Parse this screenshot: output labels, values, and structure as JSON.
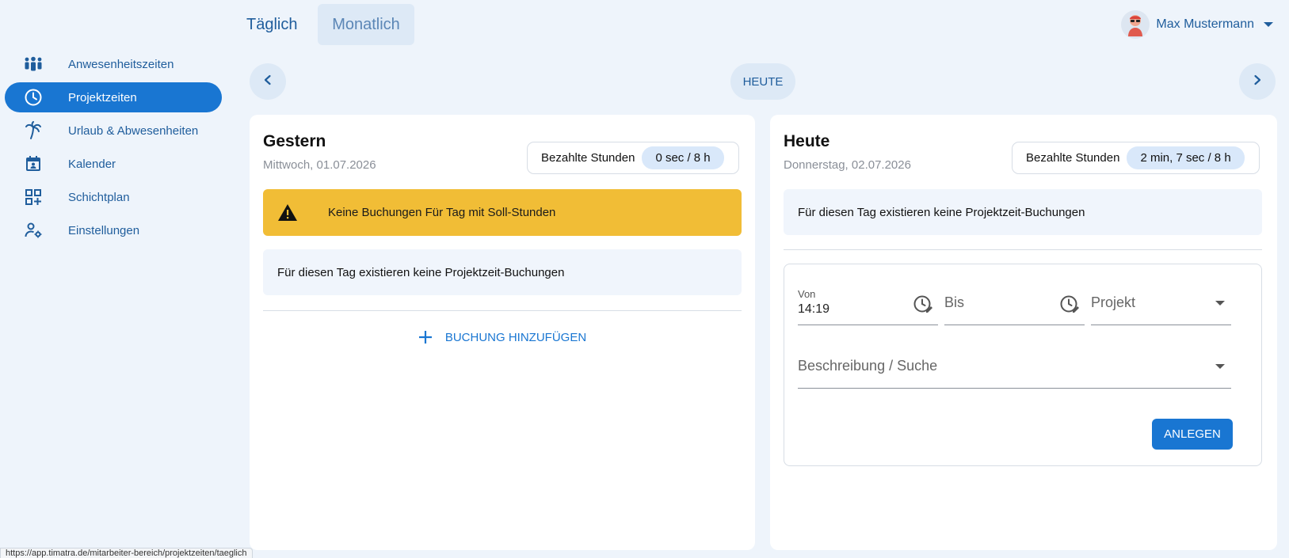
{
  "sidebar": {
    "items": [
      {
        "label": "Anwesenheitszeiten",
        "icon": "people-icon"
      },
      {
        "label": "Projektzeiten",
        "icon": "clock-icon",
        "active": true
      },
      {
        "label": "Urlaub & Abwesenheiten",
        "icon": "palm-tree-icon"
      },
      {
        "label": "Kalender",
        "icon": "calendar-icon"
      },
      {
        "label": "Schichtplan",
        "icon": "grid-plus-icon"
      },
      {
        "label": "Einstellungen",
        "icon": "user-settings-icon"
      }
    ]
  },
  "header": {
    "tab_daily": "Täglich",
    "tab_monthly": "Monatlich",
    "user_name": "Max Mustermann"
  },
  "date_nav": {
    "today_label": "HEUTE"
  },
  "left_card": {
    "title": "Gestern",
    "date": "Mittwoch, 01.07.2026",
    "paid_hours_label": "Bezahlte Stunden",
    "paid_hours_value": "0 sec / 8 h",
    "warning": "Keine Buchungen Für Tag mit Soll-Stunden",
    "info": "Für diesen Tag existieren keine Projektzeit-Buchungen",
    "add_label": "BUCHUNG HINZUFÜGEN"
  },
  "right_card": {
    "title": "Heute",
    "date": "Donnerstag, 02.07.2026",
    "paid_hours_label": "Bezahlte Stunden",
    "paid_hours_value": "2 min, 7 sec / 8 h",
    "info": "Für diesen Tag existieren keine Projektzeit-Buchungen",
    "form": {
      "from_label": "Von",
      "from_value": "14:19",
      "to_placeholder": "Bis",
      "project_placeholder": "Projekt",
      "description_placeholder": "Beschreibung / Suche",
      "submit_label": "ANLEGEN"
    }
  },
  "status_bar": {
    "url": "https://app.timatra.de/mitarbeiter-bereich/projektzeiten/taeglich"
  },
  "colors": {
    "accent": "#1976d2",
    "warning": "#f1bd36",
    "background": "#eef4fb"
  }
}
